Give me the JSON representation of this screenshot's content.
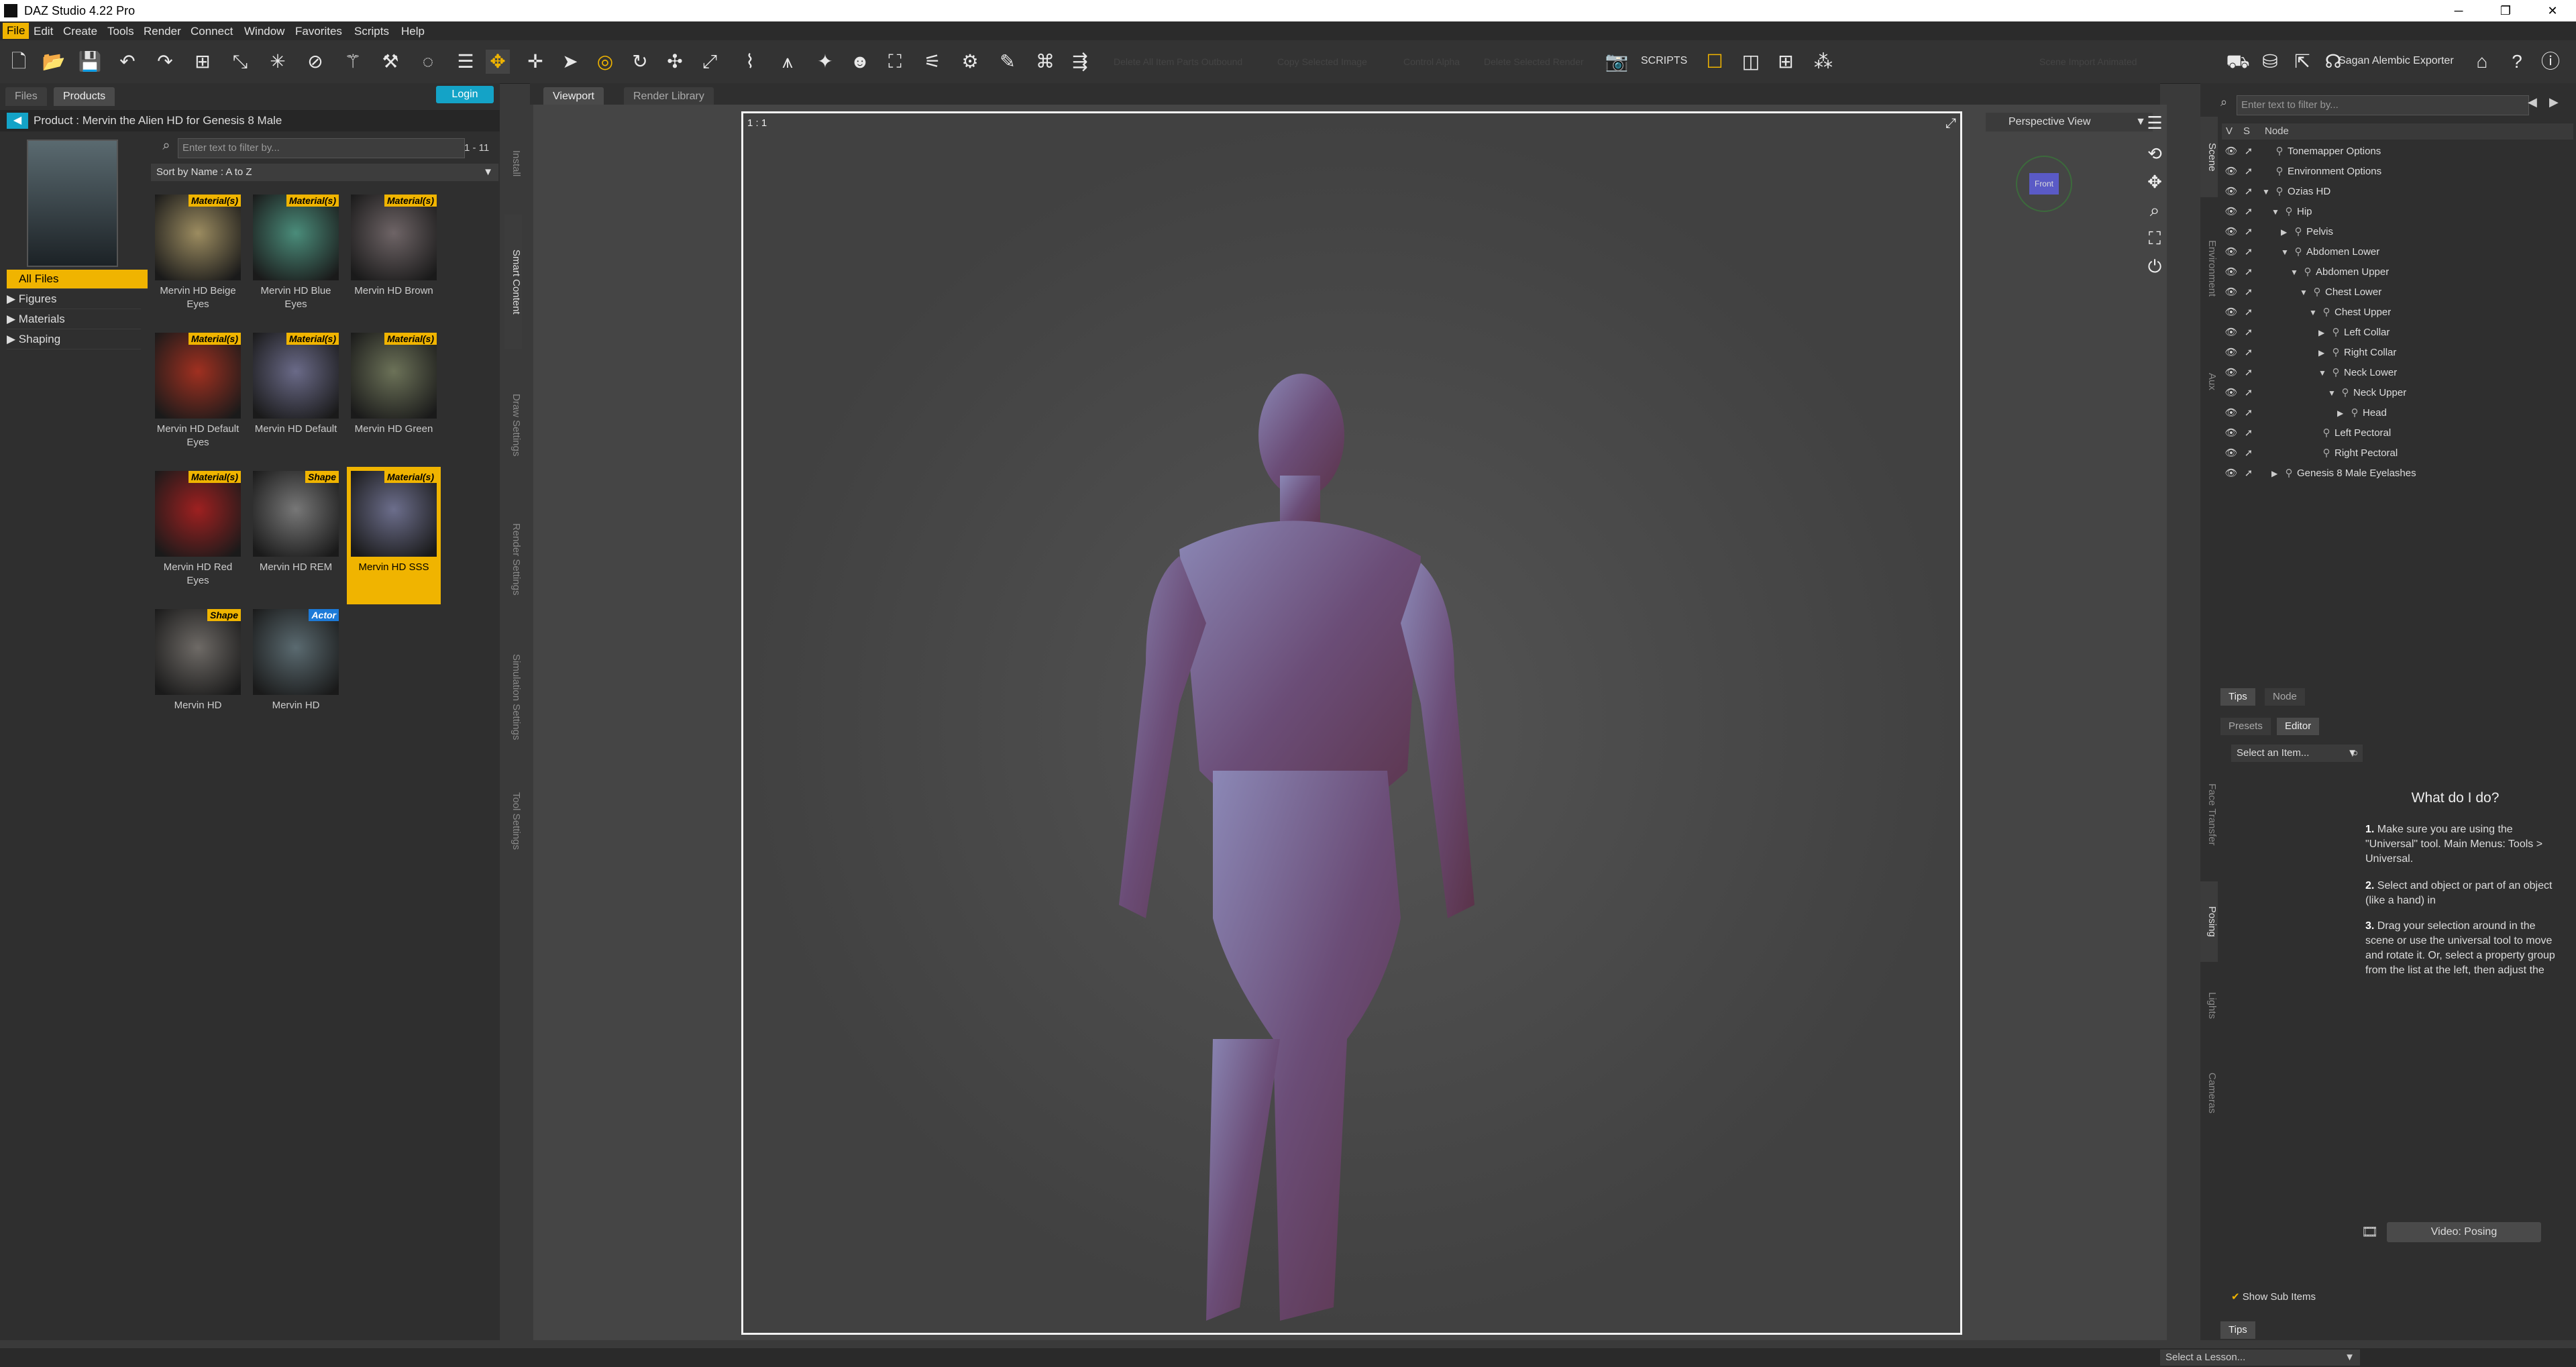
{
  "window": {
    "title": "DAZ Studio 4.22 Pro"
  },
  "menu": [
    "File",
    "Edit",
    "Create",
    "Tools",
    "Render",
    "Connect",
    "Window",
    "Favorites",
    "Scripts",
    "Help"
  ],
  "toolbar": {
    "scripts_label": "SCRIPTS",
    "exporter_label": "Sagan Alembic Exporter",
    "faded_labels": [
      "Delete All Item Parts Outbound",
      "Copy Selected Image",
      "Control Alpha",
      "Delete Selected Render",
      "Scene Import Animated"
    ]
  },
  "left_panel": {
    "tabs": [
      "Files",
      "Products"
    ],
    "login": "Login",
    "product_title": "Product : Mervin the Alien HD for Genesis 8 Male",
    "categories": [
      "All Files",
      "Figures",
      "Materials",
      "Shaping"
    ],
    "filter": {
      "placeholder": "Enter text to filter by...",
      "count": "1 - 11"
    },
    "sort": "Sort by Name : A to Z",
    "items": [
      {
        "label": "Mervin HD Beige Eyes",
        "badge": "Material(s)",
        "color": "#9c8c60"
      },
      {
        "label": "Mervin HD Blue Eyes",
        "badge": "Material(s)",
        "color": "#4a8c7a"
      },
      {
        "label": "Mervin HD Brown",
        "badge": "Material(s)",
        "color": "#6e6466"
      },
      {
        "label": "Mervin HD Default Eyes",
        "badge": "Material(s)",
        "color": "#a03020"
      },
      {
        "label": "Mervin HD Default",
        "badge": "Material(s)",
        "color": "#6a6a88"
      },
      {
        "label": "Mervin HD Green",
        "badge": "Material(s)",
        "color": "#6c7258"
      },
      {
        "label": "Mervin HD Red Eyes",
        "badge": "Material(s)",
        "color": "#9e2020"
      },
      {
        "label": "Mervin HD REM",
        "badge": "Shape",
        "color": "#777777"
      },
      {
        "label": "Mervin HD SSS",
        "badge": "Material(s)",
        "color": "#6c6e8c"
      },
      {
        "label": "Mervin HD",
        "badge": "Shape",
        "color": "#6e6a66"
      },
      {
        "label": "Mervin HD",
        "badge": "Actor",
        "color": "#5a6a70"
      }
    ],
    "side_tabs": [
      "Install",
      "Smart Content",
      "Draw Settings",
      "Render Settings",
      "Simulation Settings",
      "Tool Settings"
    ]
  },
  "viewport": {
    "tabs": [
      "Viewport",
      "Render Library"
    ],
    "ratio": "1 : 1",
    "view": "Perspective View",
    "cube_label": "Front"
  },
  "right_panel": {
    "side_tabs": [
      "Scene",
      "Environment",
      "Aux",
      "Face Transfer",
      "Posing",
      "Lights",
      "Cameras"
    ],
    "filter_placeholder": "Enter text to filter by...",
    "header": {
      "v": "V",
      "s": "S",
      "node": "Node"
    },
    "tree": [
      {
        "name": "Tonemapper Options",
        "depth": 0
      },
      {
        "name": "Environment Options",
        "depth": 0
      },
      {
        "name": "Ozias HD",
        "depth": 0,
        "exp": "▼"
      },
      {
        "name": "Hip",
        "depth": 1,
        "exp": "▼"
      },
      {
        "name": "Pelvis",
        "depth": 2,
        "exp": "▶"
      },
      {
        "name": "Abdomen Lower",
        "depth": 2,
        "exp": "▼"
      },
      {
        "name": "Abdomen Upper",
        "depth": 3,
        "exp": "▼"
      },
      {
        "name": "Chest Lower",
        "depth": 4,
        "exp": "▼"
      },
      {
        "name": "Chest Upper",
        "depth": 5,
        "exp": "▼"
      },
      {
        "name": "Left Collar",
        "depth": 6,
        "exp": "▶"
      },
      {
        "name": "Right Collar",
        "depth": 6,
        "exp": "▶"
      },
      {
        "name": "Neck Lower",
        "depth": 6,
        "exp": "▼"
      },
      {
        "name": "Neck Upper",
        "depth": 7,
        "exp": "▼"
      },
      {
        "name": "Head",
        "depth": 8,
        "exp": "▶"
      },
      {
        "name": "Left Pectoral",
        "depth": 5
      },
      {
        "name": "Right Pectoral",
        "depth": 5
      },
      {
        "name": "Genesis 8 Male Eyelashes",
        "depth": 1,
        "exp": "▶"
      }
    ],
    "lower_tabs": [
      "Tips",
      "Node"
    ],
    "posing_tabs": [
      "Presets",
      "Editor"
    ],
    "select_item": "Select an Item...",
    "tips": {
      "title": "What do I do?",
      "steps": [
        {
          "num": "1.",
          "text": "Make sure you are using the \"Universal\" tool. Main Menus: Tools > Universal."
        },
        {
          "num": "2.",
          "text": "Select and object or part of an object (like a hand) in"
        },
        {
          "num": "3.",
          "text": "Drag your selection around in the scene or use the universal tool to move and rotate it. Or, select a property group from the list at the left, then adjust the"
        }
      ],
      "video": "Video: Posing"
    },
    "show_sub_items": "Show Sub Items",
    "bottom_tab": "Tips"
  },
  "status": {
    "lesson": "Select a Lesson..."
  }
}
